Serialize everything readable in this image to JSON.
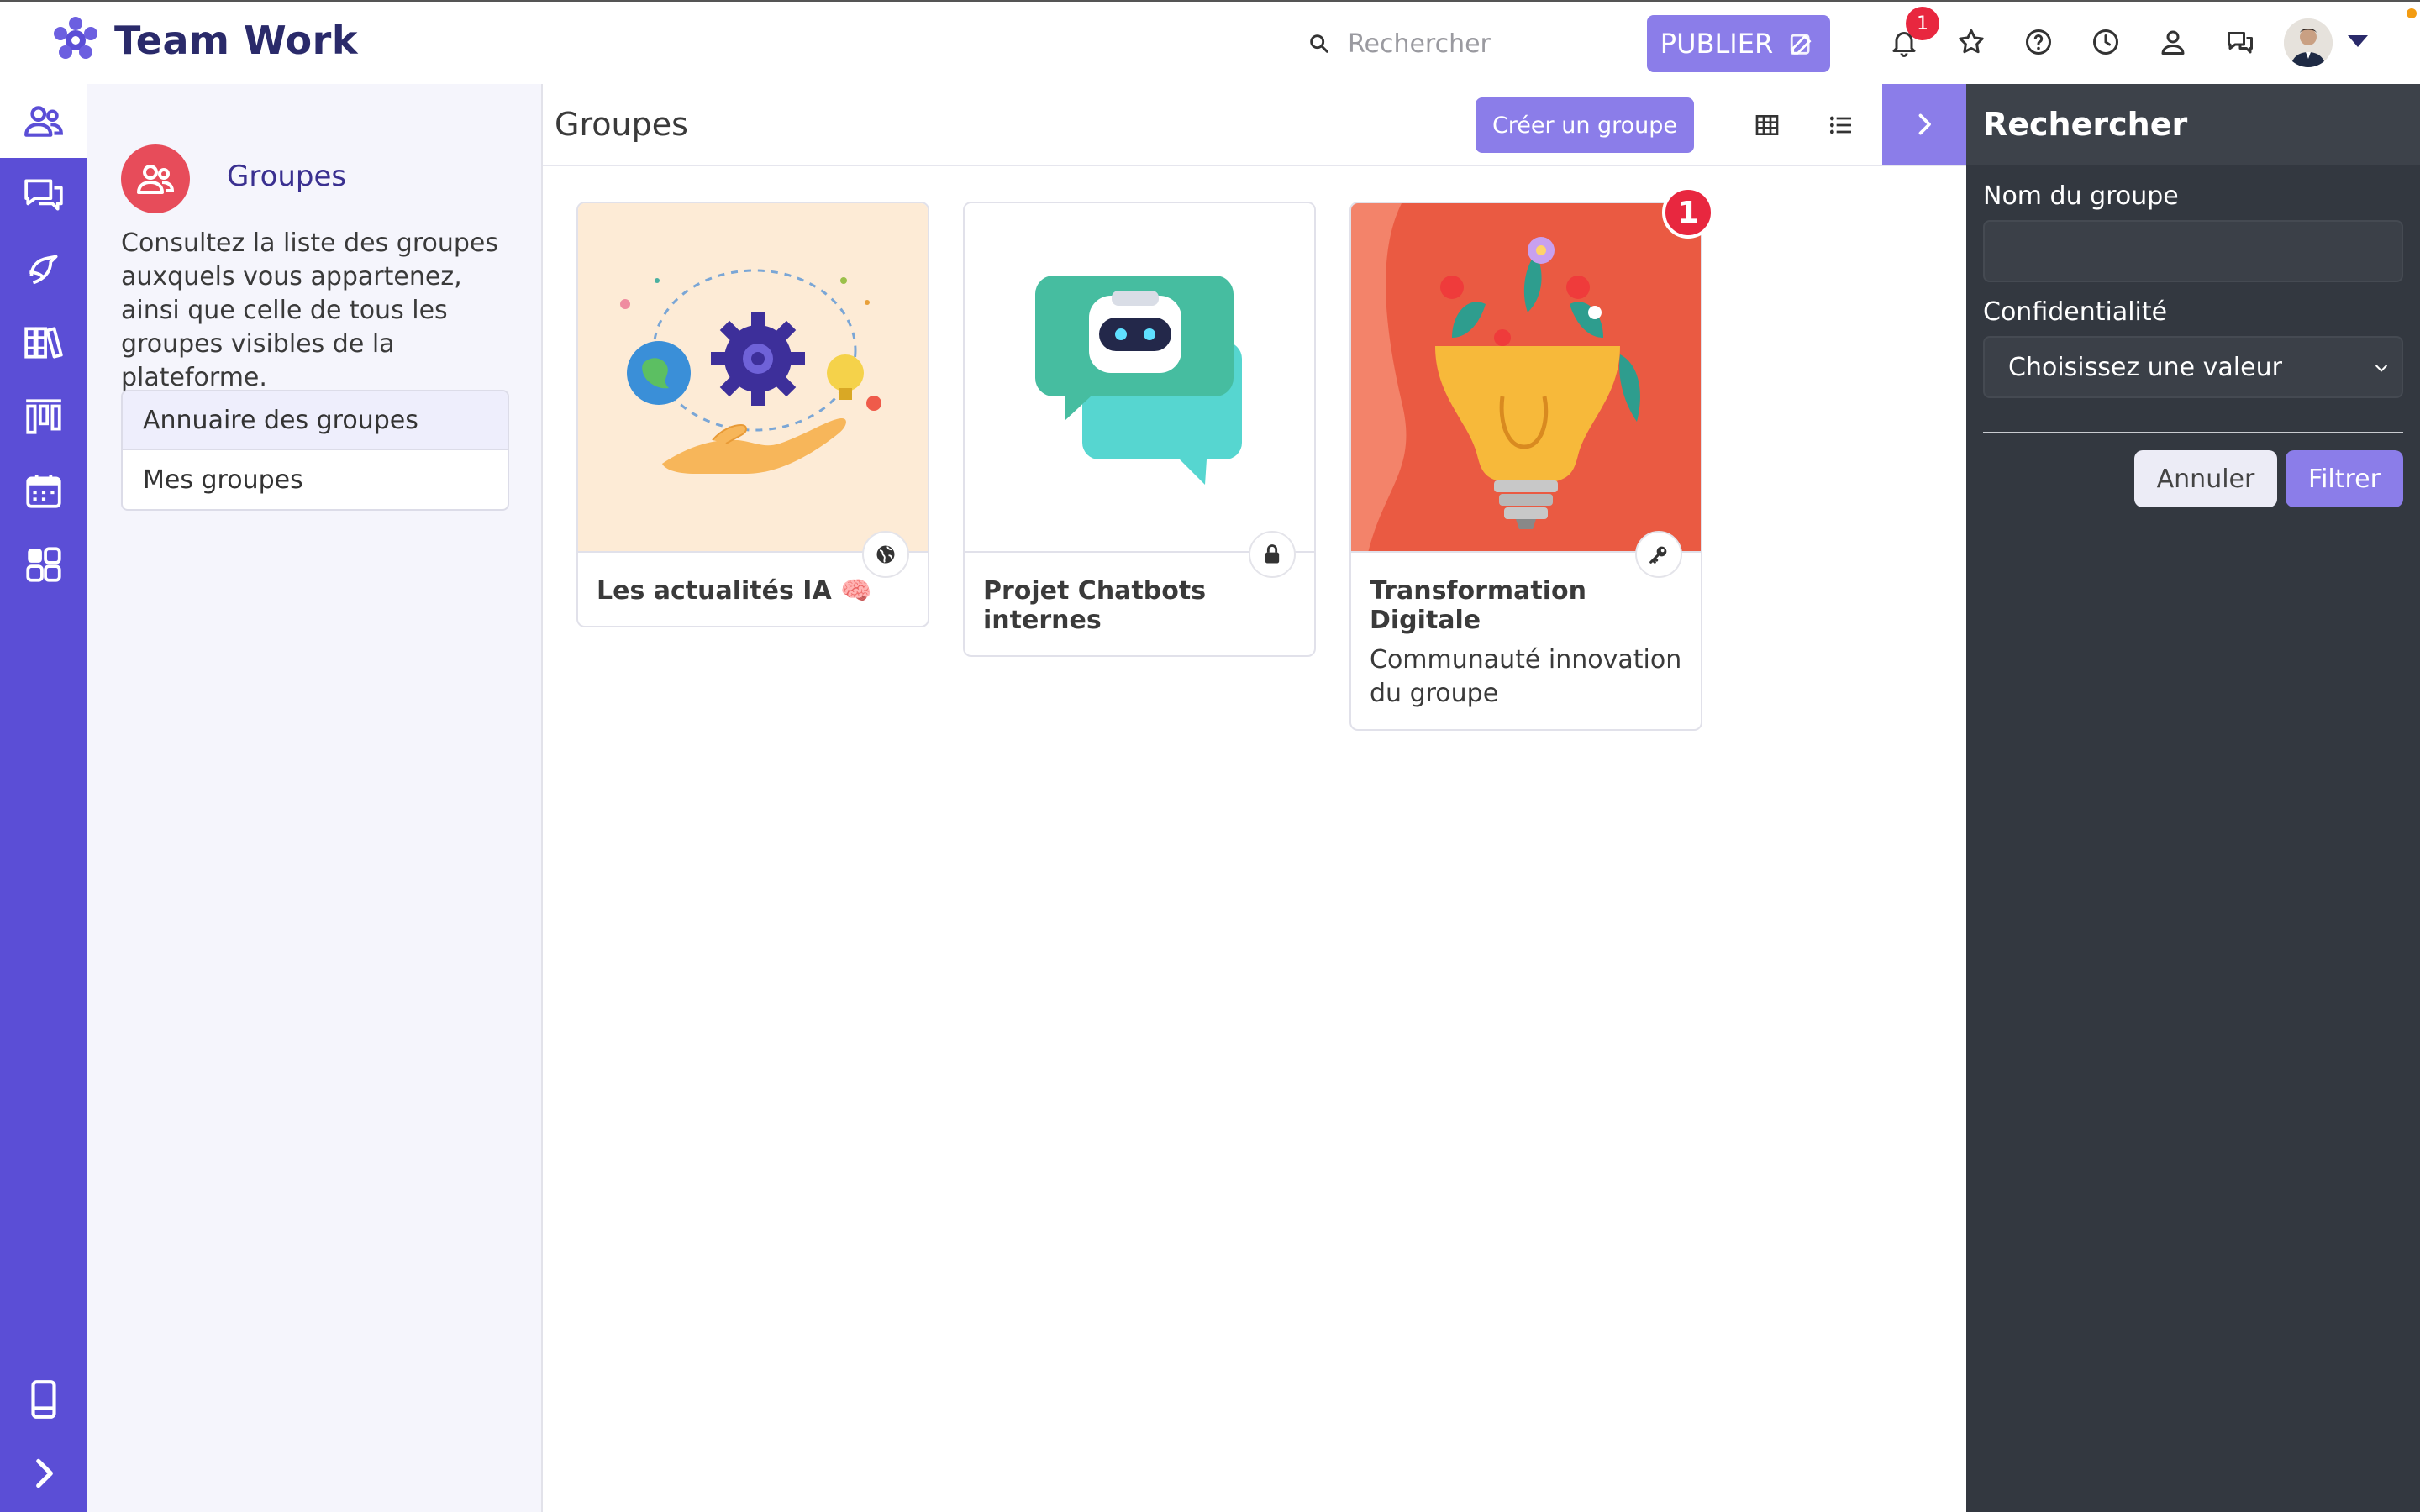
{
  "app": {
    "title": "Team Work"
  },
  "header": {
    "search_placeholder": "Rechercher",
    "publish_label": "PUBLIER",
    "notifications_count": "1",
    "icons": [
      "bell-icon",
      "star-icon",
      "help-icon",
      "clock-icon",
      "user-icon",
      "chat-icon"
    ]
  },
  "rail": {
    "items": [
      "groups-icon",
      "discussions-icon",
      "activity-icon",
      "library-icon",
      "board-icon",
      "calendar-icon",
      "apps-icon"
    ],
    "bottom": [
      "mobile-icon",
      "expand-icon"
    ]
  },
  "section": {
    "title": "Groupes",
    "description": "Consultez la liste des groupes auxquels vous appartenez, ainsi que celle de tous les groupes visibles de la plateforme.",
    "menu": [
      "Annuaire des groupes",
      "Mes groupes"
    ]
  },
  "main": {
    "title": "Groupes",
    "create_label": "Créer un groupe",
    "groups": [
      {
        "name": "Les actualités IA 🧠",
        "description": "",
        "privacy": "globe-icon"
      },
      {
        "name": "Projet Chatbots internes",
        "description": "",
        "privacy": "lock-icon"
      },
      {
        "name": "Transformation Digitale",
        "description": "Communauté innovation du groupe",
        "privacy": "key-icon",
        "badge": "1"
      }
    ]
  },
  "filter": {
    "title": "Rechercher",
    "name_label": "Nom du groupe",
    "name_value": "",
    "privacy_label": "Confidentialité",
    "privacy_value": "Choisissez une valeur",
    "cancel_label": "Annuler",
    "filter_label": "Filtrer"
  },
  "colors": {
    "accent": "#8b7de9",
    "rail": "#5b4ed6",
    "badge": "#e8273f",
    "panel": "#333840"
  }
}
